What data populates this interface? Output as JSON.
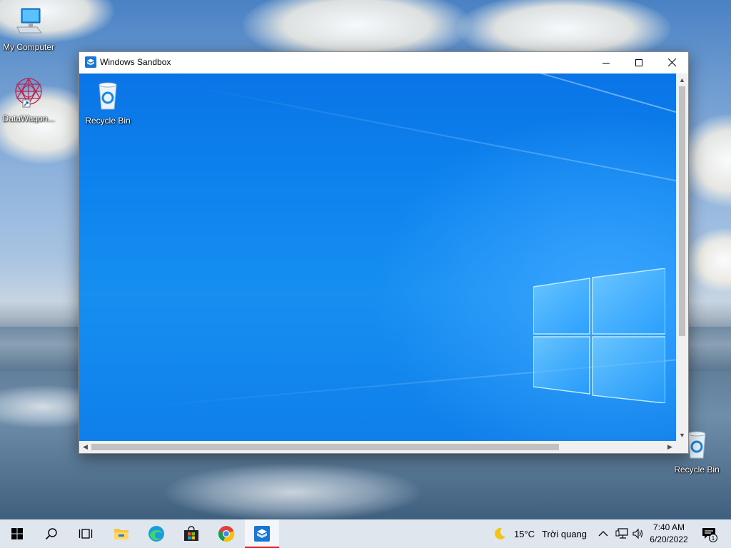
{
  "desktop": {
    "icons": [
      {
        "label": "My Computer"
      },
      {
        "label": "DataWagon..."
      },
      {
        "label": "Recycle Bin"
      }
    ]
  },
  "window": {
    "title": "Windows Sandbox",
    "controls": [
      "minimize",
      "maximize",
      "close"
    ],
    "sandbox_desktop": {
      "icons": [
        {
          "label": "Recycle Bin"
        }
      ]
    }
  },
  "taskbar": {
    "items": [
      "start",
      "search",
      "task-view",
      "file-explorer",
      "edge",
      "microsoft-store",
      "chrome",
      "windows-sandbox"
    ],
    "active_item": "windows-sandbox",
    "weather": {
      "temp": "15°C",
      "condition": "Trời quang"
    },
    "clock": {
      "time": "7:40 AM",
      "date": "6/20/2022"
    },
    "notification_count": "1"
  },
  "colors": {
    "sandbox_blue": "#0a74e6",
    "taskbar": "#dfe6ee",
    "active_indicator": "#e21b1b"
  }
}
